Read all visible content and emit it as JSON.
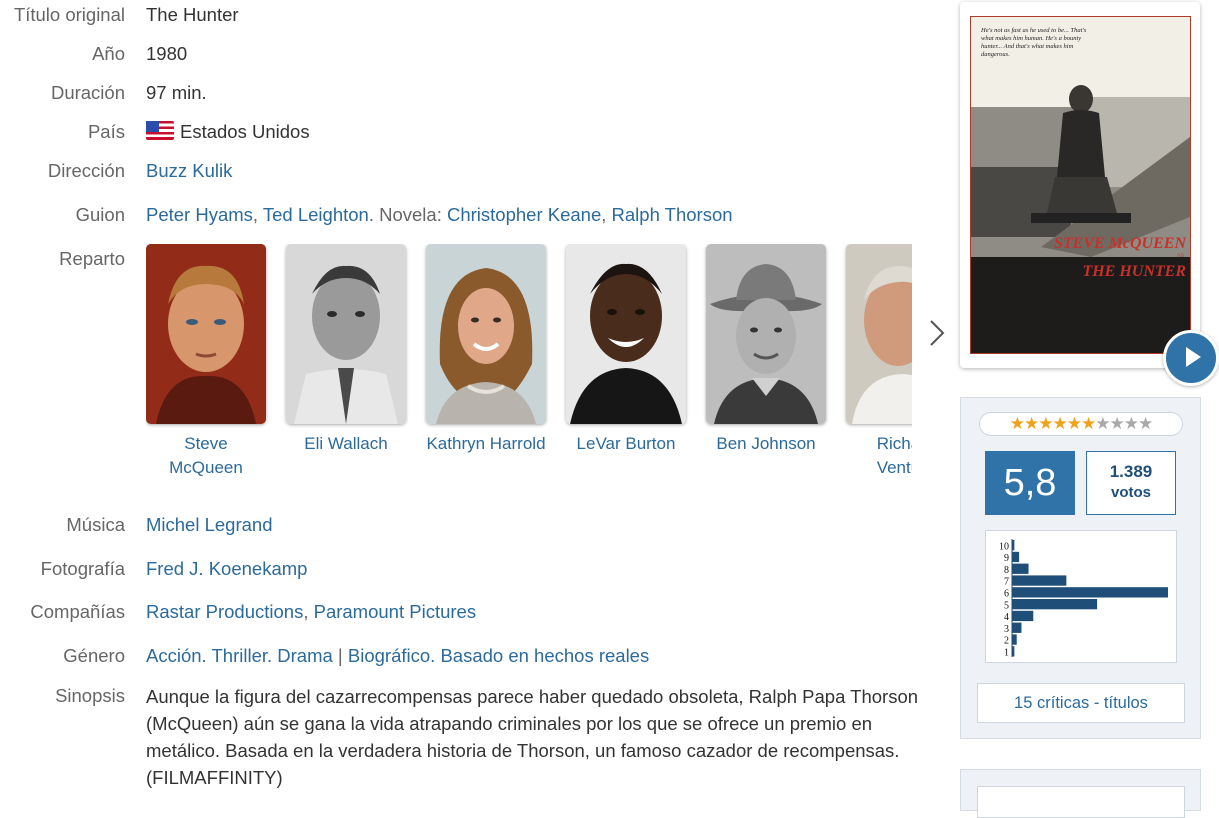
{
  "fields": {
    "titulo": {
      "label": "Título original",
      "value": "The Hunter"
    },
    "anio": {
      "label": "Año",
      "value": "1980"
    },
    "duracion": {
      "label": "Duración",
      "value": "97 min."
    },
    "pais": {
      "label": "País",
      "value": "Estados Unidos"
    },
    "direccion": {
      "label": "Dirección",
      "value": "Buzz Kulik"
    },
    "guion": {
      "label": "Guion",
      "writers": [
        "Peter Hyams",
        "Ted Leighton"
      ],
      "novel_prefix": ". Novela: ",
      "novelists": [
        "Christopher Keane",
        "Ralph Thorson"
      ],
      "comma": ", "
    },
    "reparto": {
      "label": "Reparto"
    },
    "musica": {
      "label": "Música",
      "value": "Michel Legrand"
    },
    "fotografia": {
      "label": "Fotografía",
      "value": "Fred J. Koenekamp"
    },
    "companias": {
      "label": "Compañías",
      "items": [
        "Rastar Productions",
        "Paramount Pictures"
      ],
      "comma": ", "
    },
    "genero": {
      "label": "Género",
      "items": [
        "Acción",
        "Thriller",
        "Drama",
        "Biográfico",
        "Basado en hechos reales"
      ],
      "dot": ". ",
      "pipe": " | "
    },
    "sinopsis": {
      "label": "Sinopsis",
      "value": "Aunque la figura del cazarrecompensas parece haber quedado obsoleta, Ralph Papa Thorson (McQueen) aún se gana la vida atrapando criminales por los que se ofrece un premio en metálico. Basada en la verdadera historia de Thorson, un famoso cazador de recompensas. (FILMAFFINITY)"
    }
  },
  "cast": [
    {
      "name": "Steve McQueen"
    },
    {
      "name": "Eli Wallach"
    },
    {
      "name": "Kathryn Harrold"
    },
    {
      "name": "LeVar Burton"
    },
    {
      "name": "Ben Johnson"
    },
    {
      "name": "Richard Venture"
    }
  ],
  "cast_next_icon": "chevron-right-icon",
  "poster": {
    "tagline": "He's not as fast as he used to be... That's what makes him human. He's a bounty hunter... And that's what makes him dangerous.",
    "star_line": "STEVE McQUEEN",
    "as_line": "AS",
    "title_line": "THE HUNTER",
    "play_icon": "play-icon"
  },
  "rating": {
    "score": "5,8",
    "votes_count": "1.389",
    "votes_label": "votos",
    "stars_filled": 6,
    "stars_total": 10,
    "critics_link": "15 críticas - títulos",
    "histogram": {
      "labels": [
        "10",
        "9",
        "8",
        "7",
        "6",
        "5",
        "4",
        "3",
        "2",
        "1"
      ],
      "values": [
        1,
        3,
        7,
        23,
        66,
        36,
        9,
        4,
        2,
        1
      ]
    }
  },
  "colors": {
    "link": "#2b6a9b",
    "score_bg": "#2f73a8",
    "star_on": "#f0a21a"
  }
}
